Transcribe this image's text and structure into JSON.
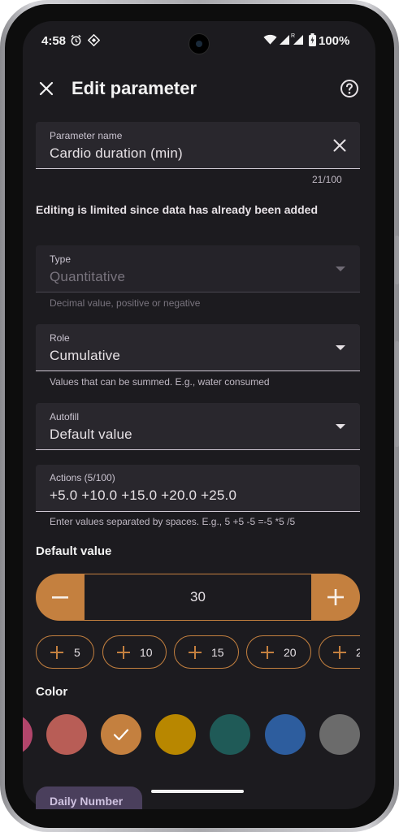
{
  "status": {
    "time": "4:58",
    "battery": "100%"
  },
  "header": {
    "title": "Edit parameter"
  },
  "name_field": {
    "label": "Parameter name",
    "value": "Cardio duration (min)",
    "counter": "21/100"
  },
  "notice": "Editing is limited since data has already been added",
  "type_field": {
    "label": "Type",
    "value": "Quantitative",
    "helper": "Decimal value, positive or negative"
  },
  "role_field": {
    "label": "Role",
    "value": "Cumulative",
    "helper": "Values that can be summed. E.g., water consumed"
  },
  "autofill_field": {
    "label": "Autofill",
    "value": "Default value"
  },
  "actions_field": {
    "label": "Actions (5/100)",
    "value": "+5.0 +10.0 +15.0 +20.0 +25.0",
    "helper": "Enter values separated by spaces. E.g., 5 +5 -5 =-5 *5 /5"
  },
  "default_value": {
    "title": "Default value",
    "value": "30"
  },
  "quick_chips": [
    {
      "label": "5"
    },
    {
      "label": "10"
    },
    {
      "label": "15"
    },
    {
      "label": "20"
    },
    {
      "label": "2"
    }
  ],
  "color_section": {
    "title": "Color"
  },
  "colors": [
    "#b2456b",
    "#b85d56",
    "#c4803f",
    "#b88700",
    "#1f5a57",
    "#2d5d9e",
    "#6b6b6b"
  ],
  "peek_chip": "Daily Number"
}
